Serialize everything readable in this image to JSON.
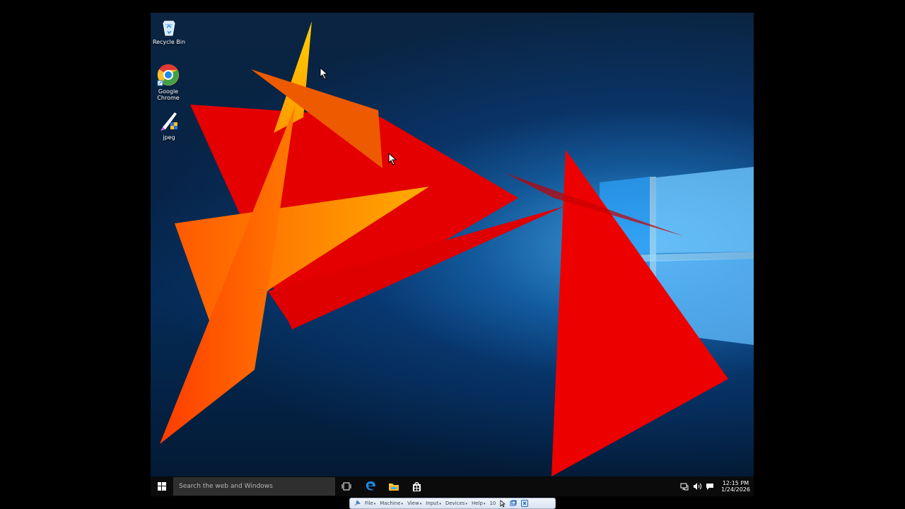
{
  "desktop": {
    "icons": [
      {
        "name": "Recycle Bin",
        "icon": "recycle-bin-icon"
      },
      {
        "name": "Google Chrome",
        "icon": "chrome-icon"
      },
      {
        "name": "jpeg",
        "icon": "jpeg-file-icon"
      }
    ]
  },
  "taskbar": {
    "start_icon": "windows-start-icon",
    "search_placeholder": "Search the web and Windows",
    "pinned": [
      {
        "name": "Task View",
        "icon": "task-view-icon"
      },
      {
        "name": "Microsoft Edge",
        "icon": "edge-icon"
      },
      {
        "name": "File Explorer",
        "icon": "file-explorer-icon"
      },
      {
        "name": "Store",
        "icon": "store-icon"
      }
    ],
    "tray_icons": [
      "network-icon",
      "volume-icon",
      "notification-icon"
    ],
    "clock": {
      "time": "12:15 PM",
      "date": "1/24/2026"
    }
  },
  "vm_toolbar": {
    "menus": [
      "File",
      "Machine",
      "View",
      "Input",
      "Devices",
      "Help"
    ],
    "number": "10"
  },
  "colors": {
    "wallpaper_glow": "#4cb6ff",
    "triangle_red": "#e80000",
    "triangle_orange": "#f36a00",
    "taskbar": "#0b0b0b"
  }
}
